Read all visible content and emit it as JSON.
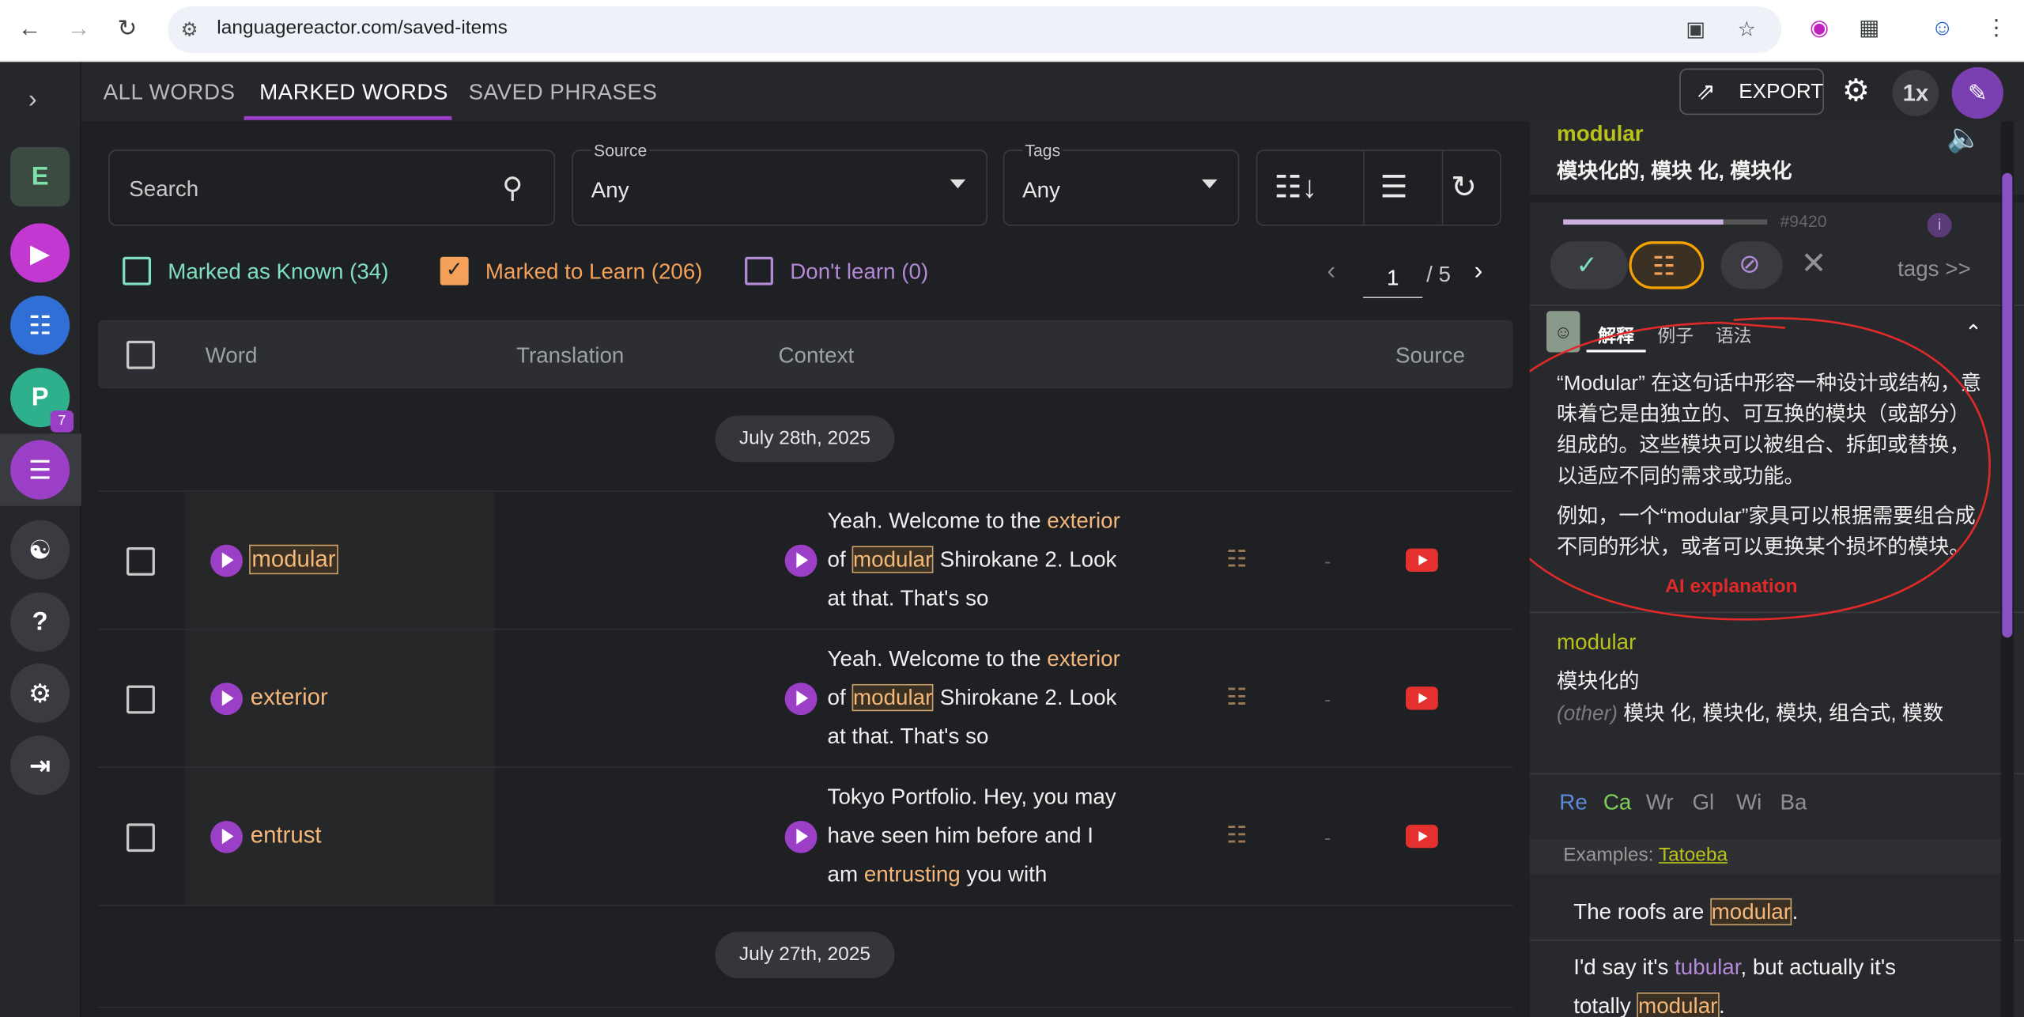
{
  "browser": {
    "url": "languagereactor.com/saved-items"
  },
  "sidebar": {
    "badge": "7",
    "e_label": "E"
  },
  "tabs": [
    "ALL WORDS",
    "MARKED WORDS",
    "SAVED PHRASES"
  ],
  "header": {
    "export_label": "EXPORT",
    "speed_label": "1x"
  },
  "filters": {
    "search_placeholder": "Search",
    "source_label": "Source",
    "source_value": "Any",
    "tags_label": "Tags",
    "tags_value": "Any"
  },
  "status_filters": {
    "known": "Marked as Known (34)",
    "learn": "Marked to Learn (206)",
    "dont": "Don't learn (0)"
  },
  "pagination": {
    "current": "1",
    "total": "/ 5"
  },
  "table": {
    "headers": {
      "word": "Word",
      "translation": "Translation",
      "context": "Context",
      "source": "Source"
    },
    "dates": [
      "July 28th, 2025",
      "July 27th, 2025"
    ],
    "rows": [
      {
        "word": "modular",
        "ctx": [
          "Yeah. Welcome to the ",
          "exterior",
          "of ",
          "modular",
          " Shirokane 2. Look",
          "at that. That's so"
        ],
        "dash": "-"
      },
      {
        "word": "exterior",
        "ctx": [
          "Yeah. Welcome to the ",
          "exterior",
          "of ",
          "modular",
          " Shirokane 2. Look",
          "at that. That's so"
        ],
        "dash": "-"
      },
      {
        "word": "entrust",
        "ctx": [
          "Tokyo Portfolio. Hey, you may",
          "have seen him before and I",
          "am ",
          "entrusting",
          " you with"
        ],
        "dash": "-"
      }
    ]
  },
  "panel": {
    "word": "modular",
    "translations": "模块化的, 模块 化, 模块化",
    "rank": "#9420",
    "tags_link": "tags >>",
    "ai_tabs": [
      "解释",
      "例子",
      "语法"
    ],
    "ai_para1": "“Modular” 在这句话中形容一种设计或结构，意味着它是由独立的、可互换的模块（或部分）组成的。这些模块可以被组合、拆卸或替换，以适应不同的需求或功能。",
    "ai_para2": "例如，一个“modular”家具可以根据需要组合成不同的形状，或者可以更换某个损坏的模块。",
    "ai_annotation": "AI explanation",
    "meaning_word": "modular",
    "meaning_main": "模块化的",
    "meaning_other_label": "(other)",
    "meaning_other": " 模块 化, 模块化, 模块, 组合式, 模数",
    "dicts": [
      "Re",
      "Ca",
      "Wr",
      "Gl",
      "Wi",
      "Ba"
    ],
    "examples_label": "Examples: ",
    "examples_source": "Tatoeba",
    "example1": [
      "The roofs are ",
      "modular",
      "."
    ],
    "example2": [
      "I'd say it's ",
      "tubular",
      ", but actually it's",
      "totally ",
      "modular",
      "."
    ]
  },
  "colors": {
    "accent": "#9b3fc7",
    "word_orange": "#f5b87a",
    "panel_word": "#b8c21a",
    "known_green": "#7fe0c0",
    "learn_orange": "#f5a15a",
    "dont_purple": "#b48ad8",
    "annotation_red": "#e02a2a"
  }
}
